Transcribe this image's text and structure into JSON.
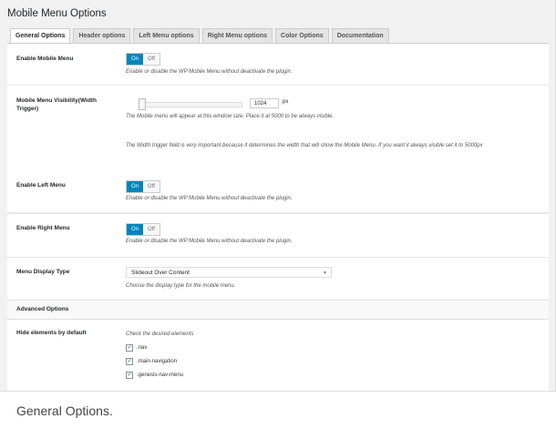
{
  "page": {
    "title": "Mobile Menu Options",
    "caption": "General Options."
  },
  "tabs": [
    {
      "label": "General Options",
      "active": true
    },
    {
      "label": "Header options"
    },
    {
      "label": "Left Menu options"
    },
    {
      "label": "Right Menu options"
    },
    {
      "label": "Color Options"
    },
    {
      "label": "Documentation"
    }
  ],
  "settings": {
    "enable_mobile": {
      "label": "Enable Mobile Menu",
      "on": "On",
      "off": "Off",
      "desc": "Enable or disable the WP Mobile Menu without deactivate the plugin."
    },
    "visibility": {
      "label": "Mobile Menu Visibility(Width Trigger)",
      "value": "1024",
      "unit": "px",
      "desc": "The Mobile menu will appear at this window size. Place it at 5000 to be always visible.",
      "note": "The Width trigger field is very important because it determines the width that will show the Mobile Menu. If you want it always visible set it to 5000px"
    },
    "enable_left": {
      "label": "Enable Left Menu",
      "on": "On",
      "off": "Off",
      "desc": "Enable or disable the WP Mobile Menu without deactivate the plugin."
    },
    "enable_right": {
      "label": "Enable Right Menu",
      "on": "On",
      "off": "Off",
      "desc": "Enable or disable the WP Mobile Menu without deactivate the plugin."
    },
    "display_type": {
      "label": "Menu Display Type",
      "value": "Slideout Over Content",
      "desc": "Choose the display type for the mobile menu."
    },
    "advanced": {
      "label": "Advanced Options"
    },
    "hide_elements": {
      "label": "Hide elements by default",
      "desc": "Check the desired elements",
      "items": [
        {
          "label": ".nav",
          "checked": true
        },
        {
          "label": ".main-navigation",
          "checked": true
        },
        {
          "label": ".genesis-nav-menu",
          "checked": true
        }
      ]
    }
  },
  "colors": {
    "accent": "#0085ba"
  }
}
